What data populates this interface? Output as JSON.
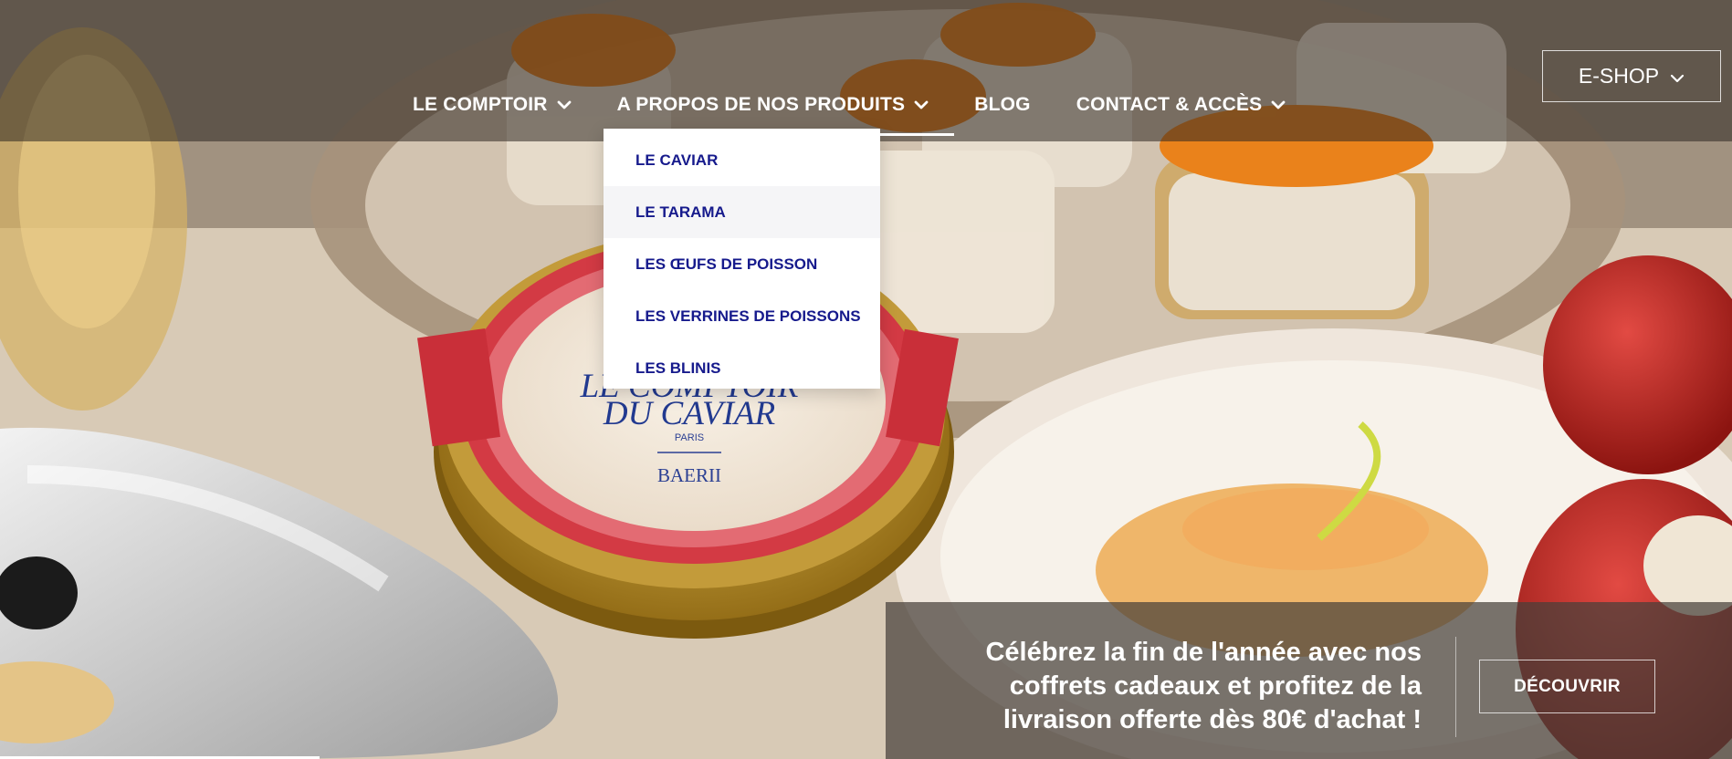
{
  "nav": {
    "items": [
      {
        "label": "LE COMPTOIR",
        "has_dropdown": true,
        "active": false
      },
      {
        "label": "A PROPOS DE NOS PRODUITS",
        "has_dropdown": true,
        "active": true
      },
      {
        "label": "BLOG",
        "has_dropdown": false,
        "active": false
      },
      {
        "label": "CONTACT & ACCÈS",
        "has_dropdown": true,
        "active": false
      }
    ],
    "eshop_label": "E-SHOP"
  },
  "dropdown": {
    "items": [
      {
        "label": "LE CAVIAR"
      },
      {
        "label": "LE TARAMA",
        "hovered": true
      },
      {
        "label": "LES ŒUFS DE POISSON"
      },
      {
        "label": "LES VERRINES DE POISSONS"
      },
      {
        "label": "LES BLINIS"
      }
    ]
  },
  "hero": {
    "tin_brand_line1": "LE COMPTOIR",
    "tin_brand_line2": "DU CAVIAR",
    "tin_city": "PARIS",
    "tin_variety": "BAERII"
  },
  "promo": {
    "text": "Célébrez la fin de l'année avec nos coffrets cadeaux et profitez de la livraison offerte dès 80€ d'achat !",
    "button_label": "DÉCOUVRIR"
  },
  "colors": {
    "menu_text": "#161a8c",
    "nav_text": "#ffffff",
    "tin_red": "#d33a44",
    "tin_gold": "#b58c2b"
  },
  "icons": {
    "nav_chevron": "chevron-down-icon",
    "eshop_chevron": "chevron-down-icon"
  }
}
